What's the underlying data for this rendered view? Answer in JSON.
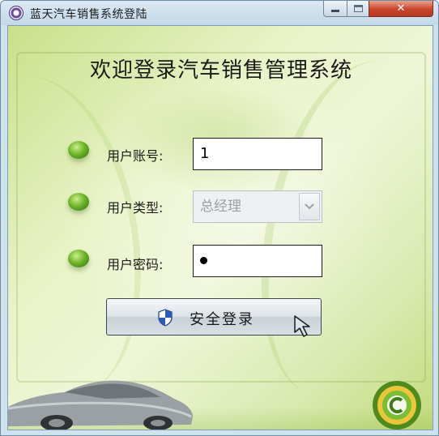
{
  "window": {
    "title": "蓝天汽车销售系统登陆",
    "app_icon": "gear-icon",
    "controls": {
      "minimize_icon": "minimize-icon",
      "maximize_icon": "maximize-icon",
      "close_glyph": "✕"
    }
  },
  "header": {
    "welcome": "欢迎登录汽车销售管理系统"
  },
  "form": {
    "account": {
      "label": "用户账号:",
      "value": "1"
    },
    "user_type": {
      "label": "用户类型:",
      "selected": "总经理",
      "disabled": true
    },
    "password": {
      "label": "用户密码:",
      "masked_length": 1
    }
  },
  "login_button": {
    "label": "安全登录",
    "icon": "shield-icon"
  },
  "colors": {
    "accent_green": "#6fb52a",
    "close_red": "#c8452b",
    "background_light": "#eef6d7"
  }
}
